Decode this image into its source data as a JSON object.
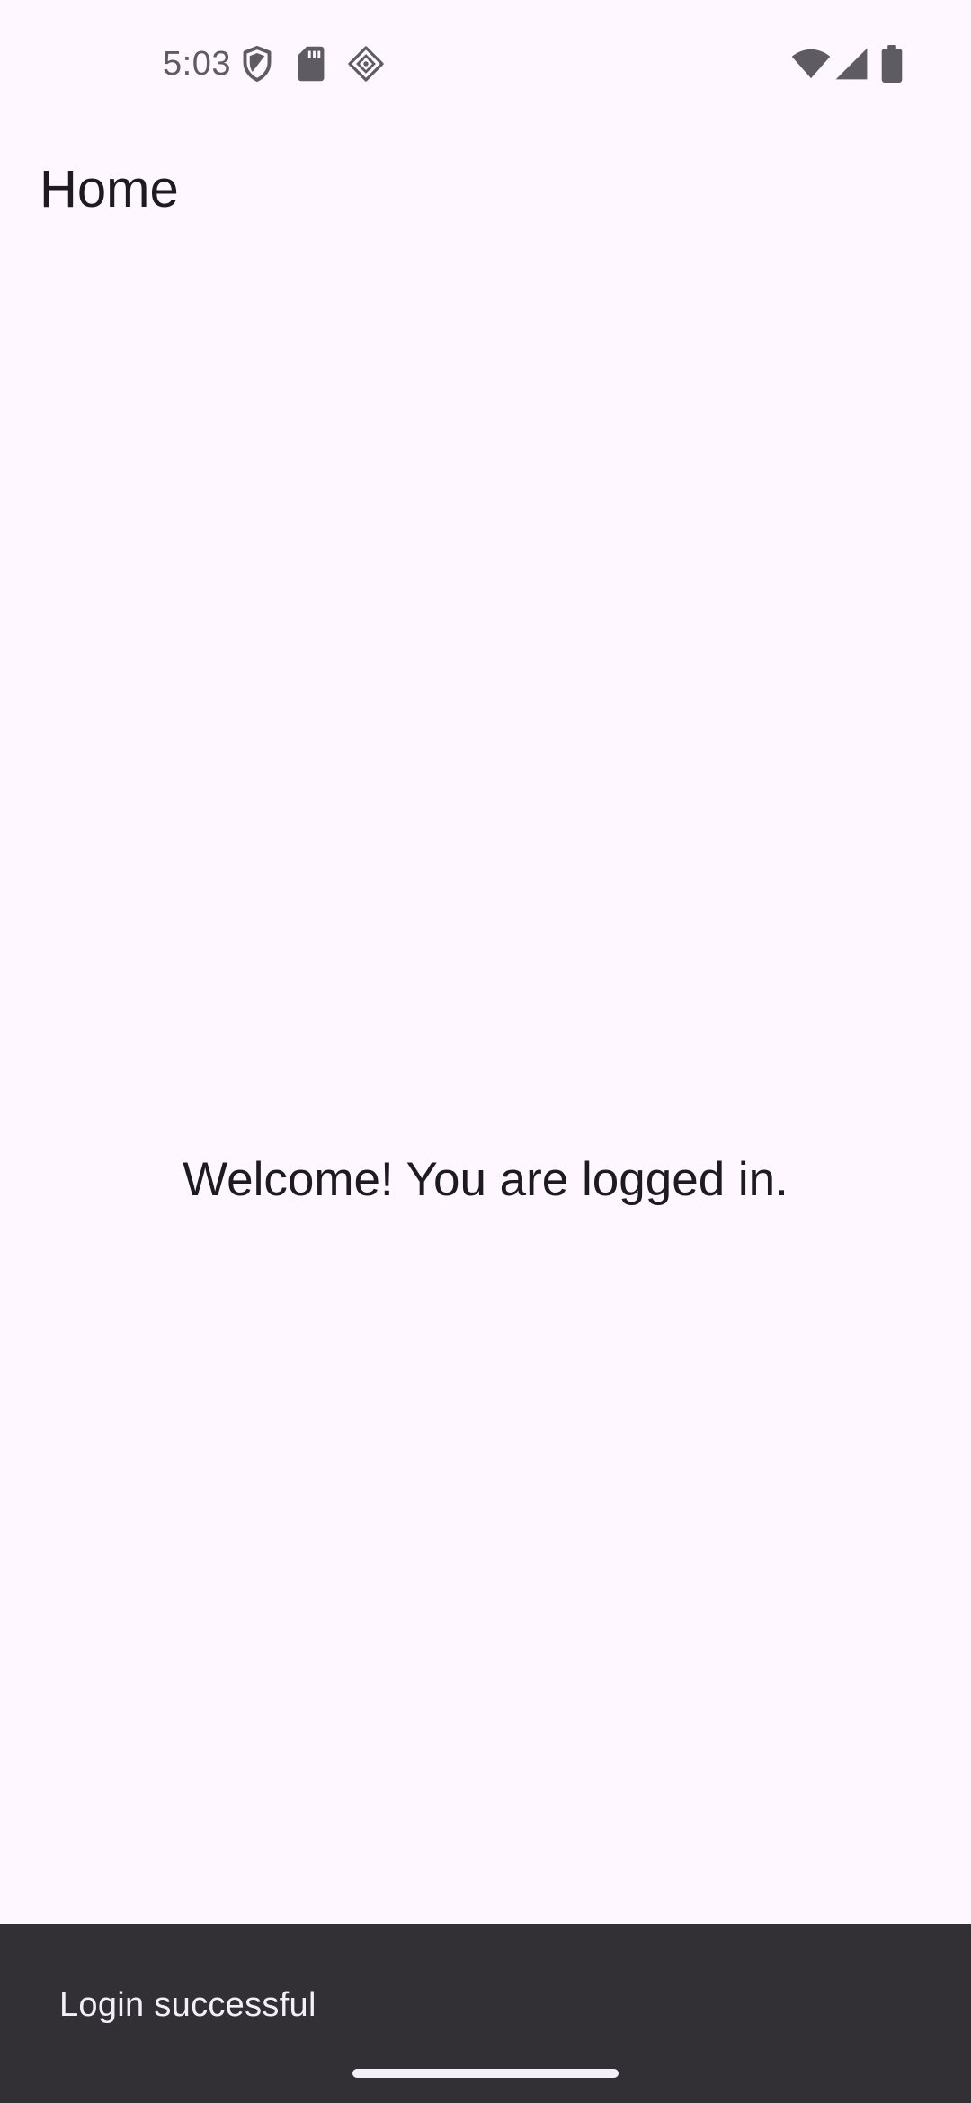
{
  "status_bar": {
    "time": "5:03",
    "icons": [
      "shield-icon",
      "sd-card-icon",
      "diamond-icon",
      "wifi-icon",
      "cellular-signal-icon",
      "battery-icon"
    ]
  },
  "app_bar": {
    "title": "Home"
  },
  "main": {
    "message": "Welcome! You are logged in."
  },
  "snackbar": {
    "message": "Login successful"
  },
  "colors": {
    "background": "#FEF7FF",
    "text": "#1D1B20",
    "status_icon": "#5f5b63",
    "snackbar_bg": "#322F35",
    "snackbar_text": "#F5EFF7"
  }
}
